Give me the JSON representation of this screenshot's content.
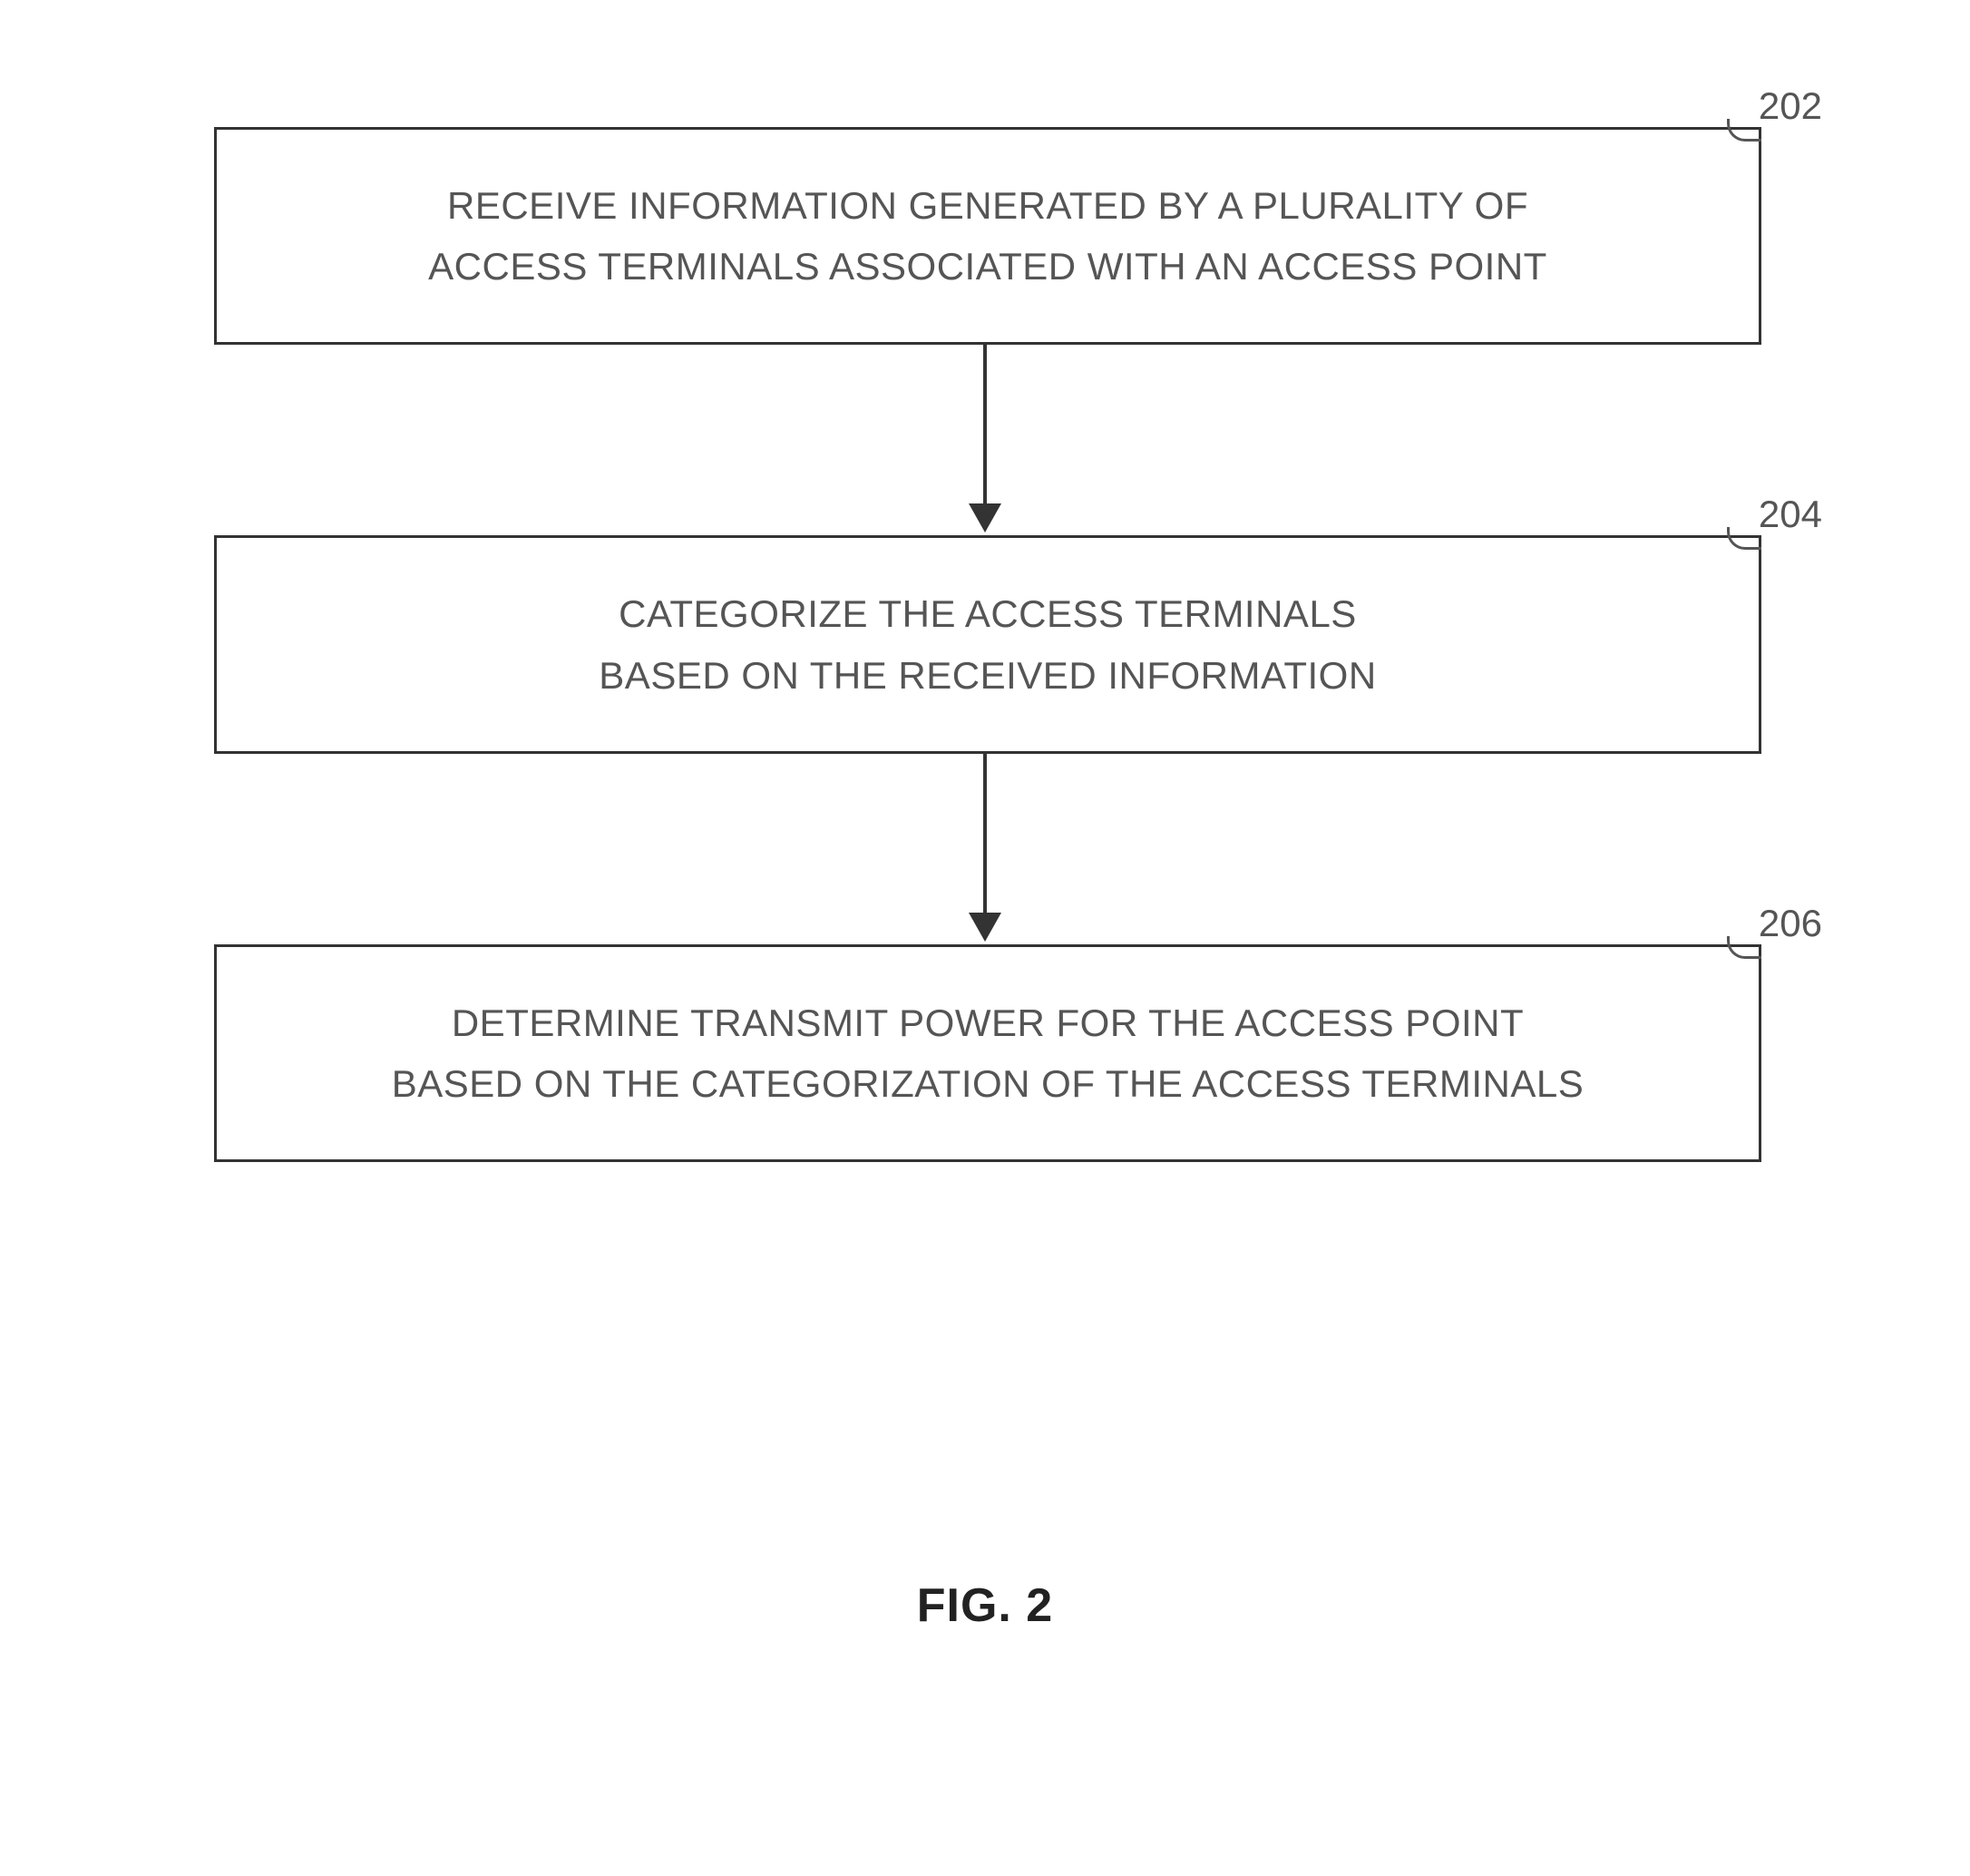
{
  "flowchart": {
    "steps": [
      {
        "label": "202",
        "lines": [
          "RECEIVE INFORMATION GENERATED BY A PLURALITY OF",
          "ACCESS TERMINALS ASSOCIATED WITH AN ACCESS POINT"
        ]
      },
      {
        "label": "204",
        "lines": [
          "CATEGORIZE THE ACCESS TERMINALS",
          "BASED ON THE RECEIVED INFORMATION"
        ]
      },
      {
        "label": "206",
        "lines": [
          "DETERMINE TRANSMIT POWER FOR THE ACCESS POINT",
          "BASED ON THE CATEGORIZATION OF THE ACCESS TERMINALS"
        ]
      }
    ]
  },
  "caption": "FIG. 2"
}
